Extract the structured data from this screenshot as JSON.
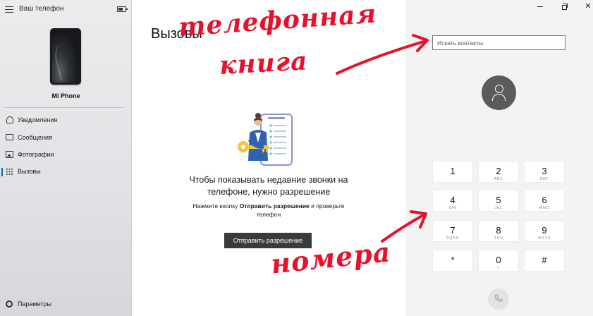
{
  "sidebar": {
    "app_title": "Ваш телефон",
    "phone_name": "Mi Phone",
    "nav": [
      {
        "label": "Уведомления",
        "icon": "bell-icon"
      },
      {
        "label": "Сообщения",
        "icon": "chat-icon"
      },
      {
        "label": "Фотографии",
        "icon": "photo-icon"
      },
      {
        "label": "Вызовы",
        "icon": "dialpad-icon",
        "active": true
      }
    ],
    "settings_label": "Параметры"
  },
  "calls": {
    "title": "Вызовы",
    "empty_heading_line1": "Чтобы показывать недавние звонки на",
    "empty_heading_line2": "телефоне, нужно разрешение",
    "hint_prefix": "Нажмите кнопку ",
    "hint_bold": "Отправить разрешение",
    "hint_suffix": " и проверьте телефон",
    "button_label": "Отправить разрешение"
  },
  "dialer": {
    "search_placeholder": "Искать контакты",
    "keys": [
      {
        "digit": "1",
        "letters": ""
      },
      {
        "digit": "2",
        "letters": "ABC"
      },
      {
        "digit": "3",
        "letters": "DEF"
      },
      {
        "digit": "4",
        "letters": "GHI"
      },
      {
        "digit": "5",
        "letters": "JKL"
      },
      {
        "digit": "6",
        "letters": "MNO"
      },
      {
        "digit": "7",
        "letters": "PQRS"
      },
      {
        "digit": "8",
        "letters": "TUV"
      },
      {
        "digit": "9",
        "letters": "WXYZ"
      },
      {
        "digit": "*",
        "letters": ""
      },
      {
        "digit": "0",
        "letters": "+"
      },
      {
        "digit": "#",
        "letters": ""
      }
    ]
  },
  "annotations": {
    "phonebook_line1": "телефонная",
    "phonebook_line2": "книга",
    "numbers": "номера",
    "color": "#e8102a"
  },
  "colors": {
    "accent": "#0067c0",
    "button_dark": "#3b3b3b",
    "avatar": "#5b5b5b"
  }
}
